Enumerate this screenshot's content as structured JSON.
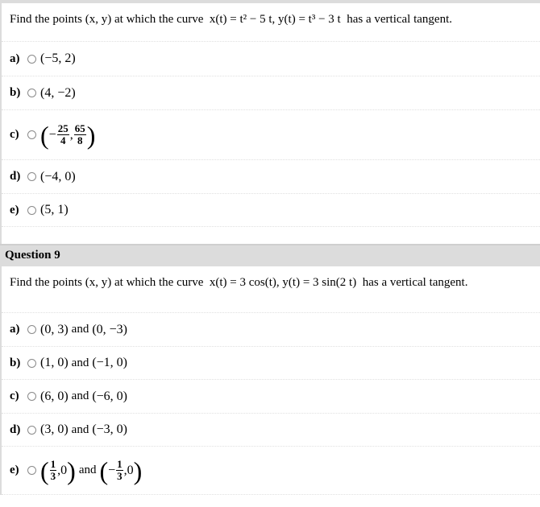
{
  "question8": {
    "prompt_prefix": "Find the points",
    "prompt_xy": "(x, y)",
    "prompt_mid": "at which the curve",
    "prompt_curve": "x(t) = t² − 5 t,  y(t) = t³ − 3 t",
    "prompt_suffix": "has a vertical tangent.",
    "options": [
      {
        "label": "a)",
        "text": "(−5, 2)"
      },
      {
        "label": "b)",
        "text": "(4, −2)"
      },
      {
        "label": "c)",
        "sign": "−",
        "num1": "25",
        "den1": "4",
        "num2": "65",
        "den2": "8"
      },
      {
        "label": "d)",
        "text": "(−4, 0)"
      },
      {
        "label": "e)",
        "text": "(5, 1)"
      }
    ]
  },
  "question9": {
    "header": "Question 9",
    "prompt_prefix": "Find the points",
    "prompt_xy": "(x, y)",
    "prompt_mid": "at which the curve",
    "prompt_curve": "x(t) = 3 cos(t),  y(t) = 3 sin(2 t)",
    "prompt_suffix": "has a vertical tangent.",
    "and_word": "and",
    "options": [
      {
        "label": "a)",
        "p1": "(0, 3)",
        "p2": "(0, −3)"
      },
      {
        "label": "b)",
        "p1": "(1, 0)",
        "p2": "(−1, 0)"
      },
      {
        "label": "c)",
        "p1": "(6, 0)",
        "p2": "(−6, 0)"
      },
      {
        "label": "d)",
        "p1": "(3, 0)",
        "p2": "(−3, 0)"
      },
      {
        "label": "e)",
        "num": "1",
        "den": "3",
        "zero": "0",
        "sign": "−"
      }
    ]
  }
}
